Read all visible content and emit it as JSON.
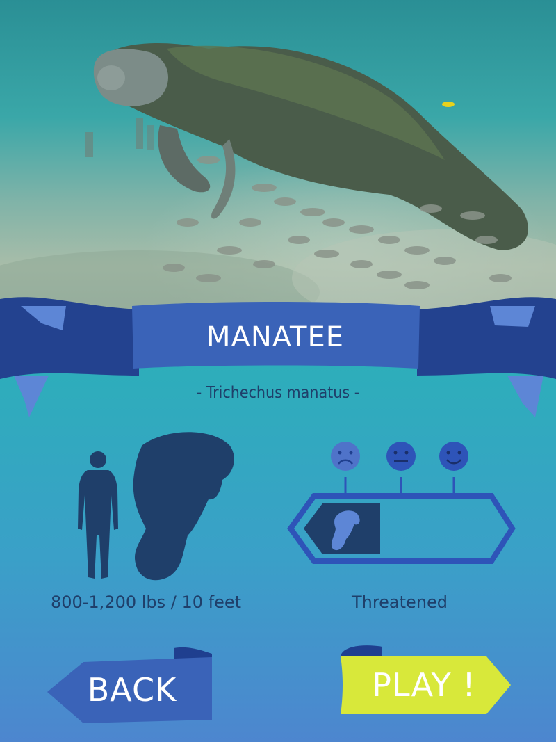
{
  "animal": {
    "name": "MANATEE",
    "scientific_name": "- Trichechus manatus -",
    "size": "800-1,200 lbs / 10 feet",
    "status": "Threatened",
    "status_level": 0.3
  },
  "status_faces": [
    "sad-face-icon",
    "neutral-face-icon",
    "happy-face-icon"
  ],
  "buttons": {
    "back": "BACK",
    "play": "PLAY !"
  },
  "colors": {
    "ribbon_dark": "#1f3f8f",
    "ribbon_mid": "#3a63b8",
    "ribbon_light": "#5d86d6",
    "silhouette": "#1f3f6a",
    "play_yellow": "#d8e83a",
    "face_blue": "#2e54b8"
  }
}
